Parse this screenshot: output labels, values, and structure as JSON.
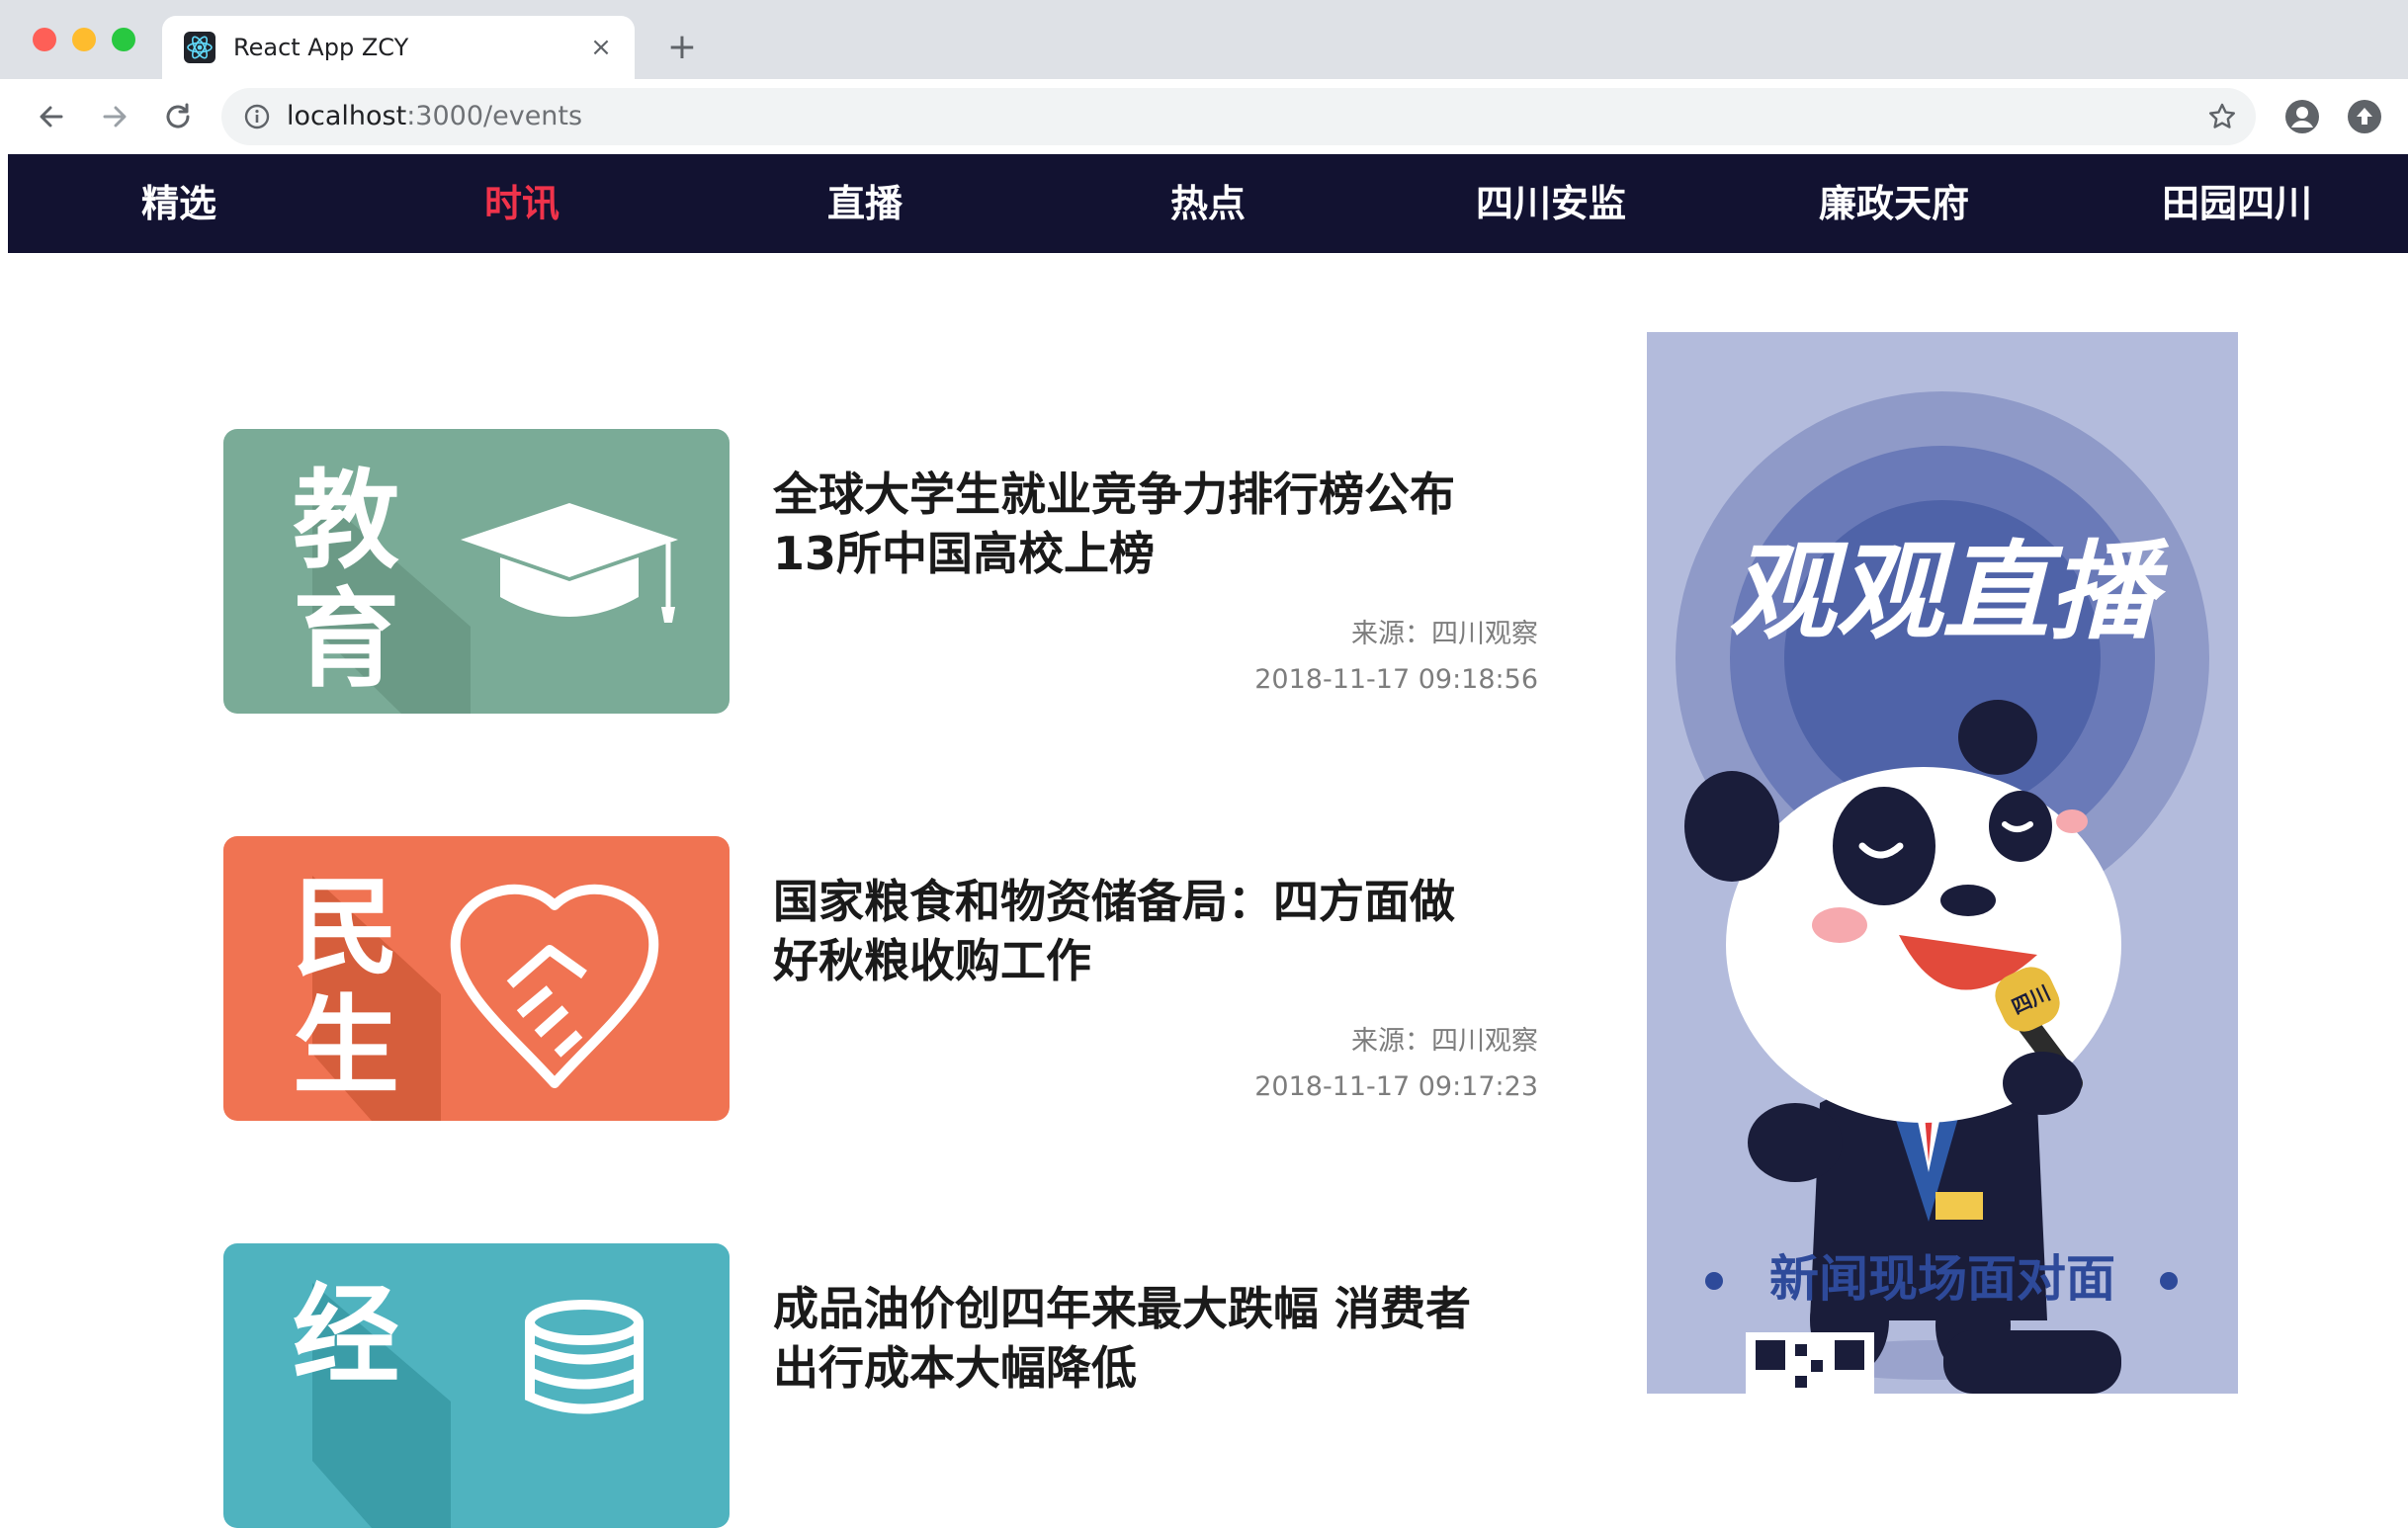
{
  "browser": {
    "tab_title": "React App ZCY",
    "tab_close": "×",
    "new_tab": "+",
    "url_host": "localhost",
    "url_path": ":3000/events"
  },
  "nav": {
    "items": [
      {
        "label": "精选",
        "active": false
      },
      {
        "label": "时讯",
        "active": true
      },
      {
        "label": "直播",
        "active": false
      },
      {
        "label": "热点",
        "active": false
      },
      {
        "label": "四川安监",
        "active": false
      },
      {
        "label": "廉政天府",
        "active": false
      },
      {
        "label": "田园四川",
        "active": false
      }
    ],
    "active_color": "#f0334b",
    "background": "#121231"
  },
  "news": [
    {
      "category": "教育",
      "cat_char_1": "教",
      "cat_char_2": "育",
      "thumb_color": "#7aab97",
      "title": "全球大学生就业竞争力排行榜公布 13所中国高校上榜",
      "source": "来源：四川观察",
      "time": "2018-11-17 09:18:56"
    },
    {
      "category": "民生",
      "cat_char_1": "民",
      "cat_char_2": "生",
      "thumb_color": "#f07352",
      "title": "国家粮食和物资储备局：四方面做好秋粮收购工作",
      "source": "来源：四川观察",
      "time": "2018-11-17 09:17:23"
    },
    {
      "category": "经济",
      "cat_char_1": "经",
      "cat_char_2": "",
      "thumb_color": "#4fb3bf",
      "title": "成品油价创四年来最大跌幅 消费者出行成本大幅降低",
      "source": "",
      "time": ""
    }
  ],
  "banner": {
    "headline": "观观直播",
    "subline": "新闻现场面对面",
    "badge_text": "四川",
    "background": "#b3bbdc"
  }
}
